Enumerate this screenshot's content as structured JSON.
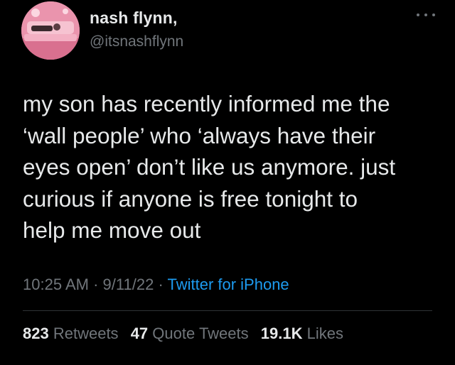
{
  "author": {
    "name": "nash flynn,",
    "handle": "@itsnashflynn",
    "avatar_icon": "profile-photo-pink-room"
  },
  "more_icon": "more-options-icon",
  "tweet": {
    "text": "my son has recently informed me the\n‘wall people’ who ‘always have their\neyes open’ don’t like us anymore. just\ncurious if anyone is free tonight to\nhelp me move out"
  },
  "meta": {
    "time": "10:25 AM",
    "separator": "·",
    "date": "9/11/22",
    "source": "Twitter for iPhone"
  },
  "stats": {
    "retweets": {
      "count": "823",
      "label": "Retweets"
    },
    "quote_tweets": {
      "count": "47",
      "label": "Quote Tweets"
    },
    "likes": {
      "count": "19.1K",
      "label": "Likes"
    }
  },
  "colors": {
    "background": "#000000",
    "primary_text": "#e7e9ea",
    "secondary_text": "#71767b",
    "link": "#1d9bf0",
    "divider": "#2f3336"
  }
}
